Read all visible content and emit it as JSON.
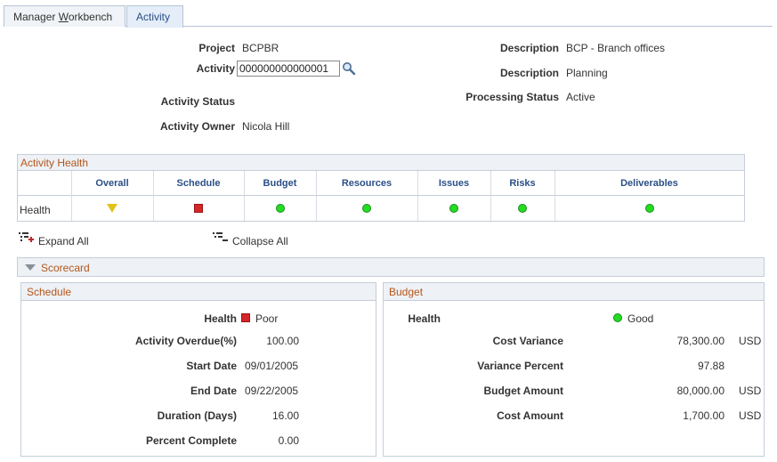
{
  "tabs": [
    {
      "label_pre": "Manager ",
      "label_underline": "W",
      "label_post": "orkbench"
    },
    {
      "label": "Activity"
    }
  ],
  "header": {
    "project_label": "Project",
    "project_value": "BCPBR",
    "activity_label": "Activity",
    "activity_value": "000000000000001",
    "activity_status_label": "Activity Status",
    "activity_status_value": "",
    "activity_owner_label": "Activity Owner",
    "activity_owner_value": "Nicola Hill",
    "description1_label": "Description",
    "description1_value": "BCP - Branch offices",
    "description2_label": "Description",
    "description2_value": "Planning",
    "processing_status_label": "Processing Status",
    "processing_status_value": "Active"
  },
  "activity_health": {
    "title": "Activity Health",
    "row_label": "Health",
    "columns": [
      "Overall",
      "Schedule",
      "Budget",
      "Resources",
      "Issues",
      "Risks",
      "Deliverables"
    ],
    "statuses": [
      "warning",
      "poor",
      "good",
      "good",
      "good",
      "good",
      "good"
    ]
  },
  "actions": {
    "expand_all": "Expand All",
    "collapse_all": "Collapse All"
  },
  "scorecard": {
    "title": "Scorecard",
    "schedule": {
      "title": "Schedule",
      "health_label": "Health",
      "health_value": "Poor",
      "overdue_label": "Activity Overdue(%)",
      "overdue_value": "100.00",
      "start_label": "Start Date",
      "start_value": "09/01/2005",
      "end_label": "End Date",
      "end_value": "09/22/2005",
      "duration_label": "Duration (Days)",
      "duration_value": "16.00",
      "percent_label": "Percent Complete",
      "percent_value": "0.00"
    },
    "budget": {
      "title": "Budget",
      "health_label": "Health",
      "health_value": "Good",
      "cost_variance_label": "Cost Variance",
      "cost_variance_value": "78,300.00",
      "cost_variance_unit": "USD",
      "variance_percent_label": "Variance Percent",
      "variance_percent_value": "97.88",
      "budget_amount_label": "Budget Amount",
      "budget_amount_value": "80,000.00",
      "budget_amount_unit": "USD",
      "cost_amount_label": "Cost Amount",
      "cost_amount_value": "1,700.00",
      "cost_amount_unit": "USD"
    }
  },
  "colors": {
    "good": "#22dd22",
    "poor": "#d4272a",
    "warning": "#e0c21b",
    "section_title": "#b3561a",
    "column_header": "#2a4f86"
  }
}
